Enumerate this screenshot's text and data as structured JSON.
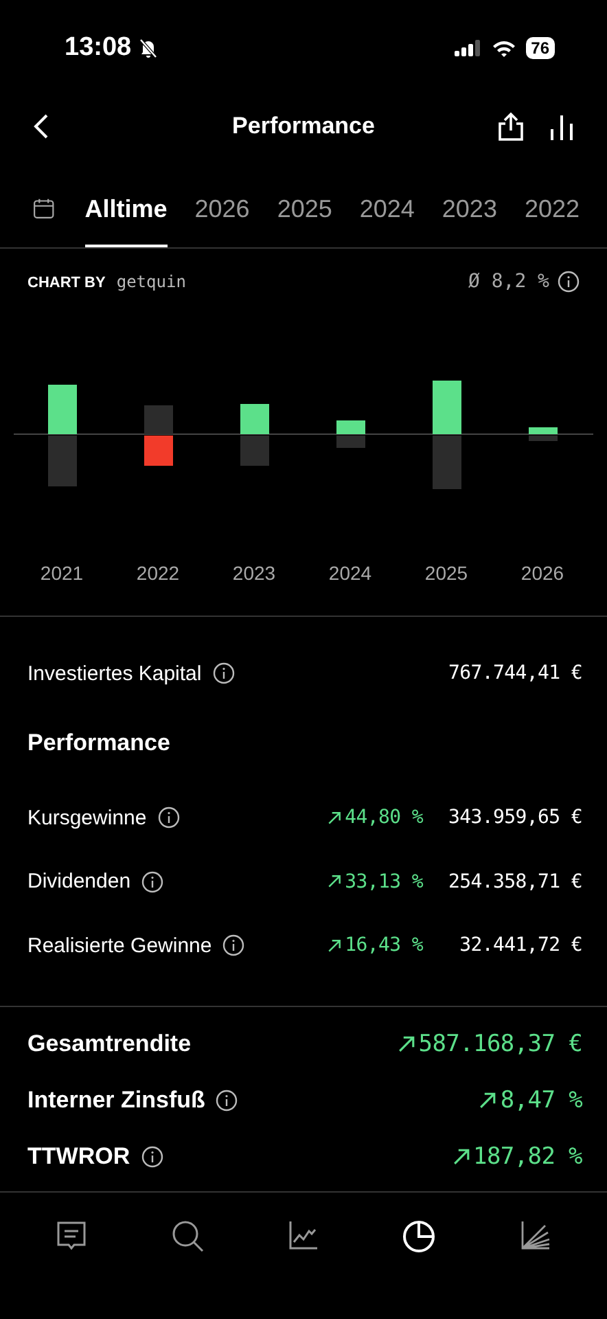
{
  "status_bar": {
    "time": "13:08",
    "silent": true,
    "battery": "76"
  },
  "header": {
    "title": "Performance"
  },
  "tabs": [
    {
      "label": "Alltime",
      "selected": true
    },
    {
      "label": "2026",
      "selected": false
    },
    {
      "label": "2025",
      "selected": false
    },
    {
      "label": "2024",
      "selected": false
    },
    {
      "label": "2023",
      "selected": false
    },
    {
      "label": "2022",
      "selected": false
    }
  ],
  "chart": {
    "caption": "CHART BY",
    "brand": "getquin",
    "average": "Ø 8,2 %",
    "years": [
      "2021",
      "2022",
      "2023",
      "2024",
      "2025",
      "2026"
    ]
  },
  "invested": {
    "label": "Investiertes Kapital",
    "info": true,
    "value": "767.744,41 €"
  },
  "performance": {
    "title": "Performance",
    "rows": [
      {
        "label": "Kursgewinne",
        "info": true,
        "rising": true,
        "percent": "44,80 %",
        "value": "343.959,65 €"
      },
      {
        "label": "Dividenden",
        "info": true,
        "rising": true,
        "percent": "33,13 %",
        "value": "254.358,71 €"
      },
      {
        "label": "Realisierte Gewinne",
        "info": true,
        "rising": true,
        "percent": "16,43 %",
        "value": "32.441,72 €"
      }
    ]
  },
  "totals": [
    {
      "label": "Gesamtrendite",
      "rising": true,
      "value": "587.168,37 €"
    },
    {
      "label": "Interner Zinsfuß",
      "info": true,
      "rising": true,
      "value": "8,47 %"
    },
    {
      "label": "TTWROR",
      "info": true,
      "rising": true,
      "value": "187,82 %"
    }
  ],
  "nav": [
    {
      "kind": "feed",
      "selected": false
    },
    {
      "kind": "search",
      "selected": false
    },
    {
      "kind": "chart",
      "selected": false
    },
    {
      "kind": "pie",
      "selected": true
    },
    {
      "kind": "analysis",
      "selected": false
    }
  ]
}
